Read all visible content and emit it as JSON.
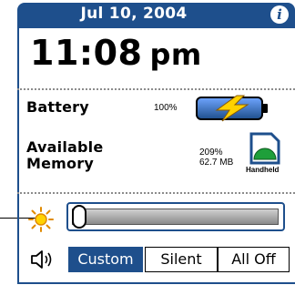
{
  "header": {
    "date": "Jul 10, 2004",
    "info_icon": "info-icon"
  },
  "clock": {
    "time": "11:08",
    "ampm": "pm"
  },
  "battery": {
    "label": "Battery",
    "percent": "100%",
    "icon": "charging-battery-icon",
    "level": 1.0
  },
  "memory": {
    "label_line1": "Available",
    "label_line2": "Memory",
    "percent": "209%",
    "size": "62.7 MB",
    "device_label": "Handheld",
    "icon": "handheld-memory-icon"
  },
  "brightness": {
    "icon": "sun-icon",
    "level": 0.0
  },
  "sound": {
    "icon": "speaker-icon",
    "options": [
      "Custom",
      "Silent",
      "All Off"
    ],
    "selected": "Custom"
  },
  "colors": {
    "accent": "#1e4f8c",
    "battery_bolt": "#ffd200",
    "memory_green": "#1e9f3a"
  }
}
